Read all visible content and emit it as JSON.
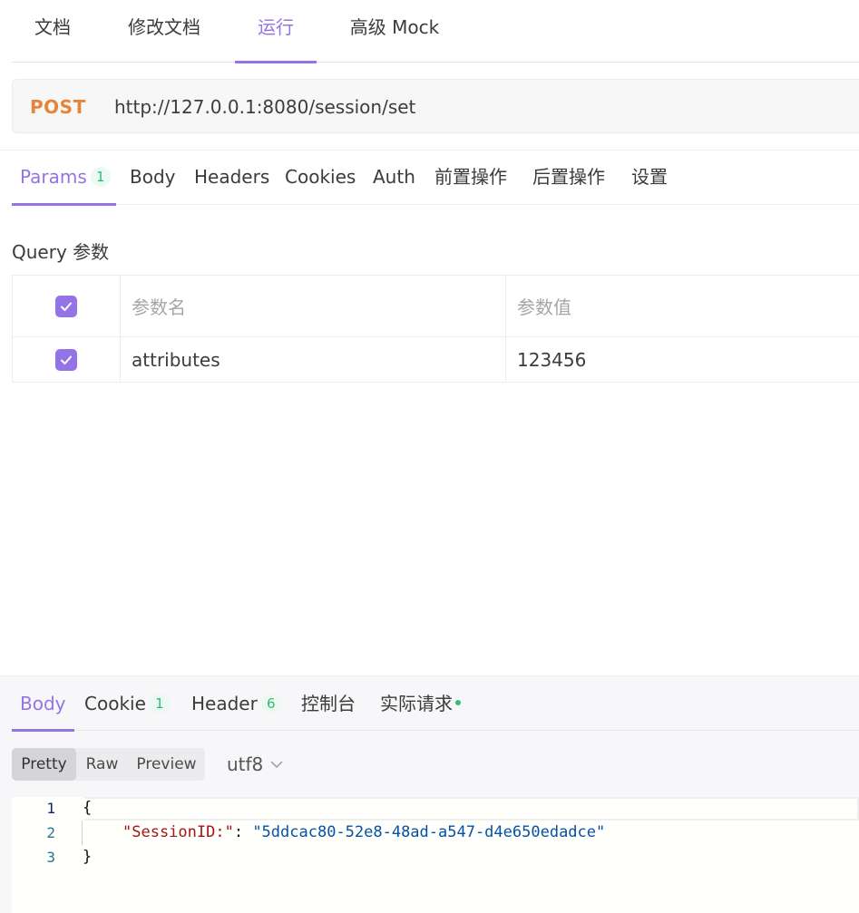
{
  "top_tabs": [
    {
      "label": "文档"
    },
    {
      "label": "修改文档"
    },
    {
      "label": "运行"
    },
    {
      "label": "高级 Mock"
    }
  ],
  "top_tabs_active": "运行",
  "request": {
    "method": "POST",
    "url": "http://127.0.0.1:8080/session/set"
  },
  "param_tabs": [
    {
      "label": "Params",
      "badge": "1"
    },
    {
      "label": "Body"
    },
    {
      "label": "Headers"
    },
    {
      "label": "Cookies"
    },
    {
      "label": "Auth"
    },
    {
      "label": "前置操作"
    },
    {
      "label": "后置操作"
    },
    {
      "label": "设置"
    }
  ],
  "param_tabs_active": "Params",
  "query": {
    "section_label": "Query 参数",
    "header": {
      "name": "参数名",
      "value": "参数值",
      "checked": true
    },
    "rows": [
      {
        "name": "attributes",
        "value": "123456",
        "checked": true
      }
    ]
  },
  "response": {
    "tabs": [
      {
        "label": "Body"
      },
      {
        "label": "Cookie",
        "badge": "1"
      },
      {
        "label": "Header",
        "badge": "6"
      },
      {
        "label": "控制台"
      },
      {
        "label": "实际请求",
        "dot": true
      }
    ],
    "active_tab": "Body",
    "view_modes": [
      "Pretty",
      "Raw",
      "Preview"
    ],
    "active_view": "Pretty",
    "encoding": "utf8",
    "code_lines": [
      {
        "num": "1",
        "text": "{"
      },
      {
        "num": "2",
        "key": "\"SessionID:\"",
        "sep": ": ",
        "value": "\"5ddcac80-52e8-48ad-a547-d4e650edadce\""
      },
      {
        "num": "3",
        "text": "}"
      }
    ]
  },
  "colors": {
    "accent": "#9373e6",
    "method": "#e8833a",
    "badge": "#2fbd74"
  }
}
